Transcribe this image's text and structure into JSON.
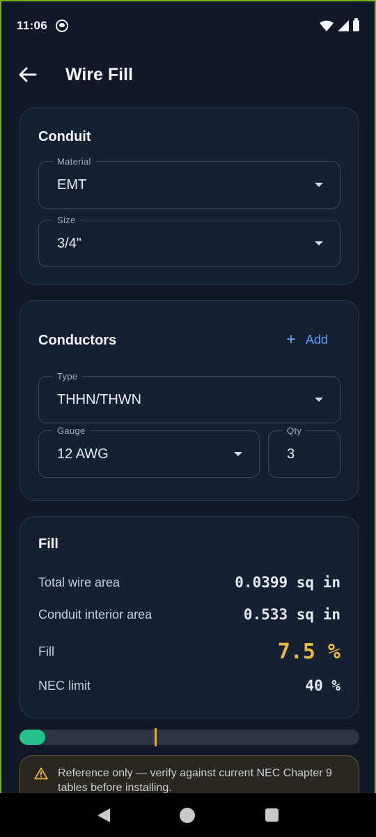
{
  "status": {
    "time": "11:06"
  },
  "header": {
    "title": "Wire Fill"
  },
  "conduit": {
    "title": "Conduit",
    "material": {
      "label": "Material",
      "value": "EMT"
    },
    "size": {
      "label": "Size",
      "value": "3/4\""
    }
  },
  "conductors": {
    "title": "Conductors",
    "add_label": "Add",
    "type": {
      "label": "Type",
      "value": "THHN/THWN"
    },
    "gauge": {
      "label": "Gauge",
      "value": "12 AWG"
    },
    "qty": {
      "label": "Qty",
      "value": "3"
    }
  },
  "fill": {
    "title": "Fill",
    "rows": [
      {
        "label": "Total wire area",
        "value": "0.0399 sq in"
      },
      {
        "label": "Conduit interior area",
        "value": "0.533 sq in"
      },
      {
        "label": "Fill",
        "value": "7.5 %"
      },
      {
        "label": "NEC limit",
        "value": "40 %"
      }
    ],
    "progress_percent": 7.5,
    "limit_percent": 40
  },
  "warning": {
    "text": "Reference only — verify against current NEC Chapter 9 tables before installing."
  },
  "colors": {
    "accent": "#5f9cff",
    "fill_value": "#e6b83b",
    "progress": "#22c28a",
    "limit_marker": "#e6a93b"
  }
}
